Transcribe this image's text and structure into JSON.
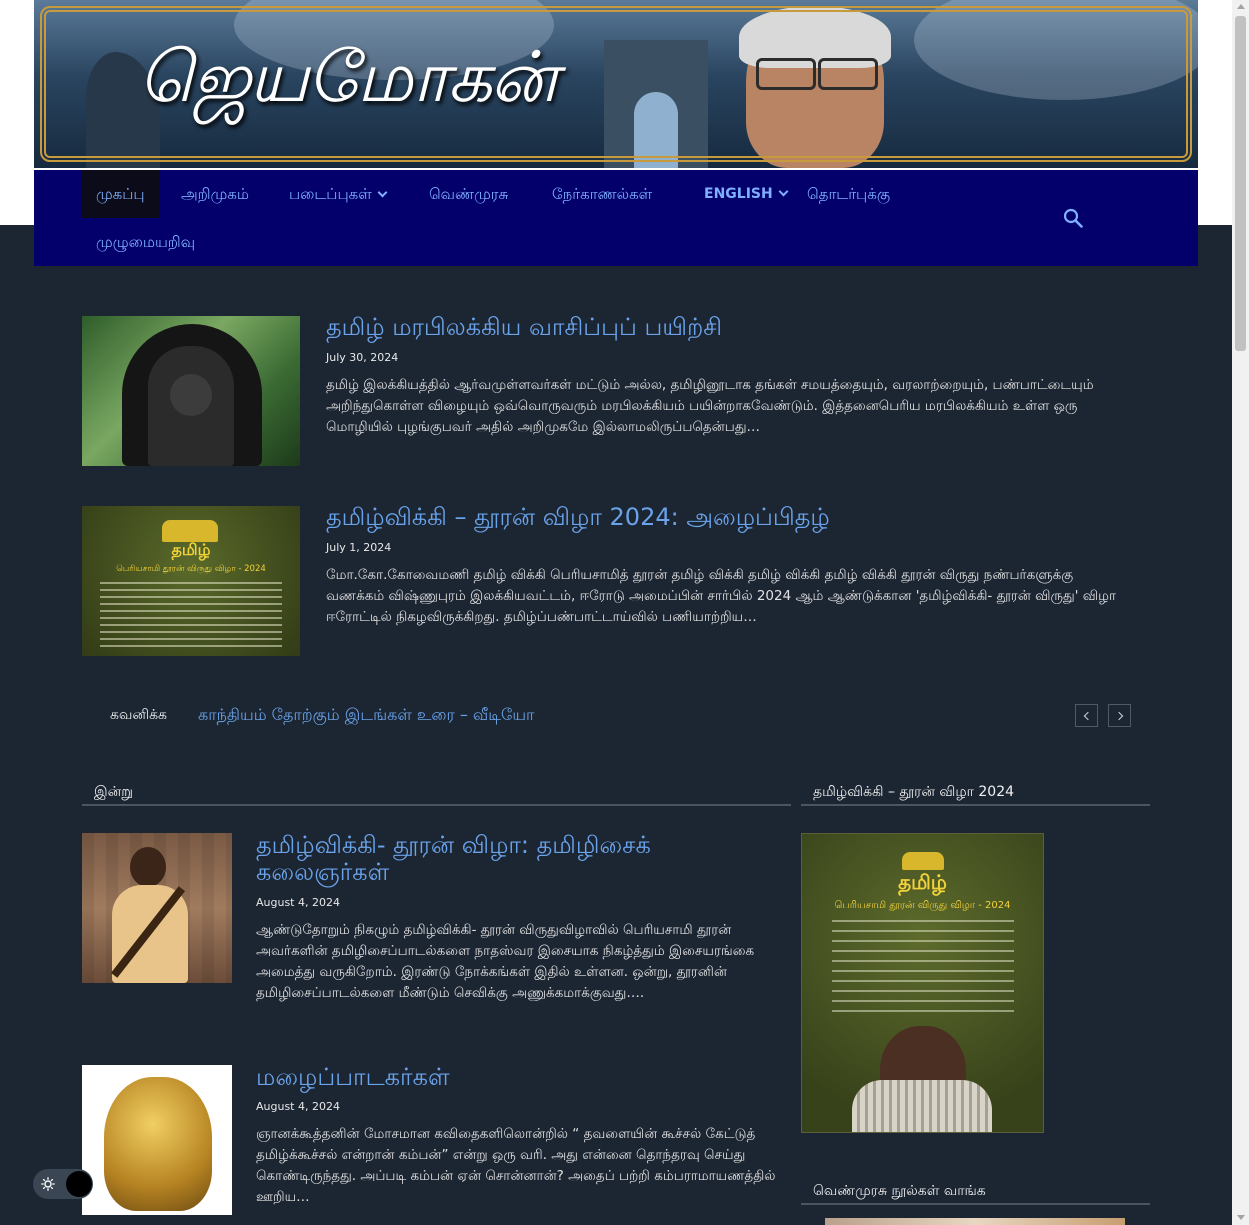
{
  "site": {
    "banner_title": "ஜெயமோகன்"
  },
  "nav": {
    "items": [
      {
        "label": "முகப்பு",
        "active": true
      },
      {
        "label": "அறிமுகம்"
      },
      {
        "label": "படைப்புகள்",
        "dropdown": true
      },
      {
        "label": "வெண்முரசு"
      },
      {
        "label": "நேர்காணல்கள்"
      },
      {
        "label": "ENGLISH",
        "dropdown": true
      },
      {
        "label": "தொடர்புக்கு"
      },
      {
        "label": "முழுமையறிவு"
      }
    ]
  },
  "featured": [
    {
      "title": "தமிழ் மரபிலக்கிய வாசிப்புப் பயிற்சி",
      "date": "July 30, 2024",
      "excerpt": "  தமிழ் இலக்கியத்தில் ஆர்வமுள்ளவர்கள் மட்டும் அல்ல, தமிழினூடாக தங்கள் சமயத்தையும், வரலாற்றையும், பண்பாட்டையும் அறிந்துகொள்ள விழையும் ஒவ்வொருவரும் மரபிலக்கியம் பயின்றாகவேண்டும். இத்தனைபெரிய மரபிலக்கியம் உள்ள ஒரு மொழியில் புழங்குபவர் அதில் அறிமுகமே இல்லாமலிருப்பதென்பது…"
    },
    {
      "title": "தமிழ்விக்கி – தூரன் விழா 2024: அழைப்பிதழ்",
      "date": "July 1, 2024",
      "excerpt": "மோ.கோ.கோவைமணி தமிழ் விக்கி பெரியசாமித் தூரன் தமிழ் விக்கி தமிழ் விக்கி தமிழ் விக்கி தூரன் விருது நண்பர்களுக்கு வணக்கம் விஷ்ணுபுரம் இலக்கியவட்டம், ஈரோடு அமைப்பின் சார்பில் 2024 ஆம் ஆண்டுக்கான 'தமிழ்விக்கி- தூரன் விருது' விழா ஈரோட்டில் நிகழவிருக்கிறது. தமிழ்ப்பண்பாட்டாய்வில் பணியாற்றிய…",
      "thumb": {
        "logo_text": "தமிழ்",
        "heading": "பெரியசாமி தூரன் விருது விழா - 2024"
      }
    }
  ],
  "ticker": {
    "label": "கவனிக்க",
    "text": "காந்தியம் தோற்கும் இடங்கள் உரை – வீடியோ"
  },
  "today": {
    "heading": "இன்று",
    "posts": [
      {
        "title_line1": "தமிழ்விக்கி- தூரன் விழா: தமிழிசைக்",
        "title_line2": "கலைஞர்கள்",
        "date": "August 4, 2024",
        "excerpt": "ஆண்டுதோறும் நிகழும் தமிழ்விக்கி- தூரன் விருதுவிழாவில் பெரியசாமி தூரன் அவர்களின் தமிழிசைப்பாடல்களை நாதஸ்வர இசையாக நிகழ்த்தும் இசையரங்கை அமைத்து வருகிறோம். இரண்டு நோக்கங்கள் இதில் உள்ளன. ஒன்று, தூரனின் தமிழிசைப்பாடல்களை மீண்டும் செவிக்கு அணுக்கமாக்குவது…."
      },
      {
        "title_line1": "மழைப்பாடகர்கள்",
        "date": "August 4, 2024",
        "excerpt": "ஞானக்கூத்தனின் மோசமான கவிதைகளிலொன்றில் “ தவளையின் கூச்சல் கேட்டுத் தமிழ்க்கூச்சல் என்றான் கம்பன்” என்று ஒரு வரி. அது என்னை தொந்தரவு செய்து கொண்டிருந்தது. அப்படி கம்பன் ஏன் சொன்னான்? அதைப் பற்றி கம்பராமாயணத்தில் ஊறிய…"
      }
    ]
  },
  "sidebar": {
    "widget1_heading": "தமிழ்விக்கி – தூரன் விழா 2024",
    "poster": {
      "logo_text": "தமிழ்",
      "heading": "பெரியசாமி தூரன் விருது விழா - 2024"
    },
    "widget2_heading": "வெண்முரசு நூல்கள் வாங்க"
  },
  "colors": {
    "background": "#1c2633",
    "nav_bg": "#03006b",
    "link": "#6aa3ea"
  }
}
